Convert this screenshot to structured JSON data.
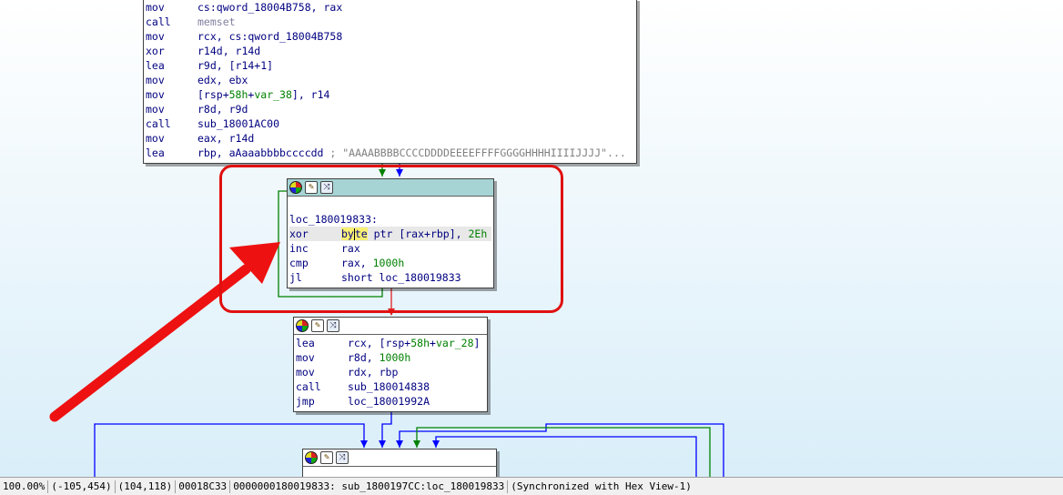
{
  "top_block": {
    "lines": [
      {
        "mnemonic": "mov",
        "operand": "cs:qword_18004B758, rax"
      },
      {
        "mnemonic": "call",
        "operand": "memset"
      },
      {
        "mnemonic": "mov",
        "operand": "rcx, cs:qword_18004B758"
      },
      {
        "mnemonic": "xor",
        "operand": "r14d, r14d"
      },
      {
        "mnemonic": "lea",
        "operand": "r9d, [r14+1]"
      },
      {
        "mnemonic": "mov",
        "operand": "edx, ebx"
      },
      {
        "mnemonic": "mov",
        "operand_pre": "[rsp+",
        "operand_num": "58h",
        "operand_mid": "+",
        "operand_var": "var_38",
        "operand_post": "], r14"
      },
      {
        "mnemonic": "mov",
        "operand": "r8d, r9d"
      },
      {
        "mnemonic": "call",
        "operand": "sub_18001AC00"
      },
      {
        "mnemonic": "mov",
        "operand": "eax, r14d"
      },
      {
        "mnemonic": "lea",
        "operand": "rbp, aAaaabbbbccccdd",
        "comment": " ; \"AAAABBBBCCCCDDDDEEEEFFFFGGGGHHHHIIIIJJJJ\"..."
      }
    ]
  },
  "loop_block": {
    "label": "loc_180019833:",
    "xor_mnemonic": "xor",
    "xor_op_a": "by",
    "xor_op_b": "te",
    "xor_op_rest": " ptr [rax+rbp], ",
    "xor_op_imm": "2Eh",
    "inc_mnemonic": "inc",
    "inc_operand": "rax",
    "cmp_mnemonic": "cmp",
    "cmp_operand": "rax, ",
    "cmp_imm": "1000h",
    "jl_mnemonic": "jl",
    "jl_operand": "short loc_180019833"
  },
  "mid_block": {
    "l1_mn": "lea",
    "l1_pre": "rcx, [rsp+",
    "l1_num": "58h",
    "l1_mid": "+",
    "l1_var": "var_28",
    "l1_post": "]",
    "l2_mn": "mov",
    "l2_pre": "r8d, ",
    "l2_imm": "1000h",
    "l3_mn": "mov",
    "l3_op": "rdx, rbp",
    "l4_mn": "call",
    "l4_op": "sub_180014838",
    "l5_mn": "jmp",
    "l5_op": "loc_18001992A"
  },
  "icons": [
    "color-wheel-icon",
    "pencil-icon",
    "graph-icon"
  ],
  "colors": {
    "highlight_box": "#e01010",
    "arrow": "#ee1111",
    "edge_true": "#008000",
    "edge_false": "#e02020",
    "edge_normal": "#0000ff",
    "header_selected": "#a6d4d4"
  },
  "status_bar": {
    "zoom": "100.00%",
    "mouse": "(-105,454)",
    "graph_pos": "(104,118)",
    "file_offset": "00018C33",
    "location": "0000000180019833: sub_1800197CC:loc_180019833",
    "sync": "(Synchronized with Hex View-1)"
  }
}
